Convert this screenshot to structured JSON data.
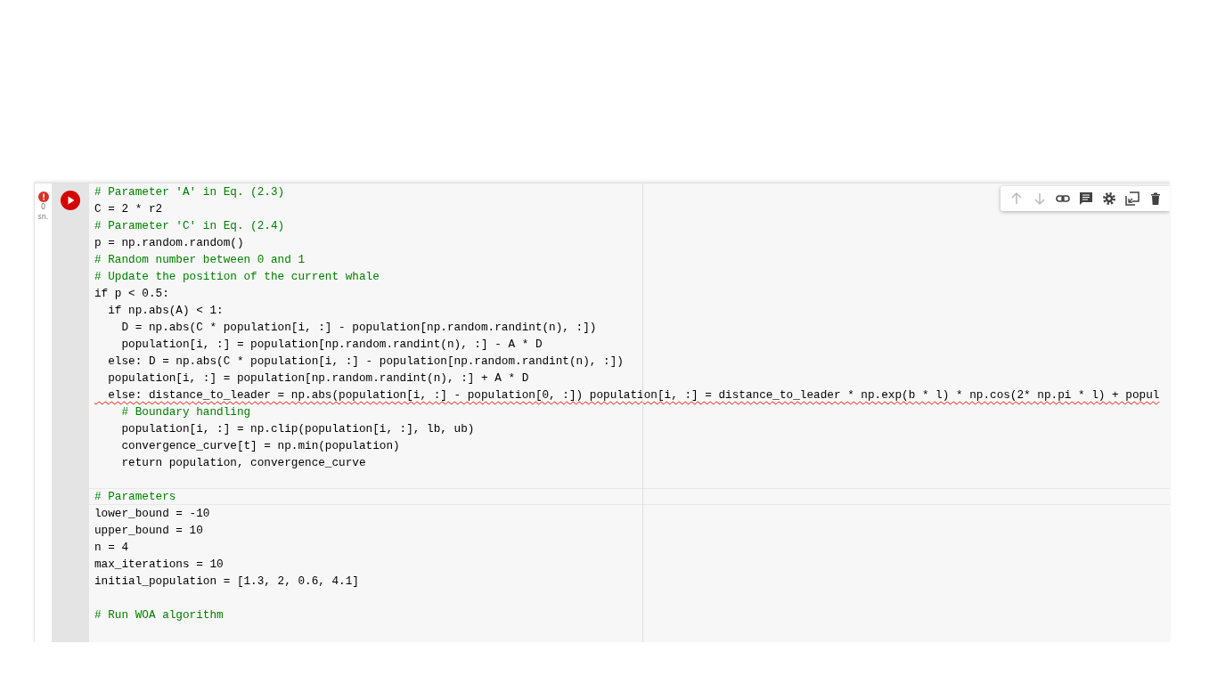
{
  "cell": {
    "status": {
      "error": true,
      "time": "0",
      "unit": "sn."
    },
    "toolbar": [
      {
        "kind": "up",
        "disabled": true
      },
      {
        "kind": "down",
        "disabled": true
      },
      {
        "kind": "link",
        "disabled": false
      },
      {
        "kind": "comment",
        "disabled": false
      },
      {
        "kind": "settings",
        "disabled": false
      },
      {
        "kind": "mirror",
        "disabled": false
      },
      {
        "kind": "delete",
        "disabled": false
      }
    ],
    "lines": [
      {
        "kind": "comment",
        "text": "# Parameter 'A' in Eq. (2.3)",
        "flagged": false
      },
      {
        "kind": "code",
        "text": "C = 2 * r2",
        "flagged": false
      },
      {
        "kind": "comment",
        "text": "# Parameter 'C' in Eq. (2.4)",
        "flagged": false
      },
      {
        "kind": "code",
        "text": "p = np.random.random()",
        "flagged": false
      },
      {
        "kind": "comment",
        "text": "# Random number between 0 and 1",
        "flagged": false
      },
      {
        "kind": "comment",
        "text": "# Update the position of the current whale",
        "flagged": false
      },
      {
        "kind": "code",
        "text": "if p < 0.5:",
        "flagged": false
      },
      {
        "kind": "code",
        "text": "  if np.abs(A) < 1:",
        "flagged": false
      },
      {
        "kind": "code",
        "text": "    D = np.abs(C * population[i, :] - population[np.random.randint(n), :])",
        "flagged": false
      },
      {
        "kind": "code",
        "text": "    population[i, :] = population[np.random.randint(n), :] - A * D",
        "flagged": false
      },
      {
        "kind": "code",
        "text": "  else: D = np.abs(C * population[i, :] - population[np.random.randint(n), :])",
        "flagged": false
      },
      {
        "kind": "code",
        "text": "  population[i, :] = population[np.random.randint(n), :] + A * D",
        "flagged": false
      },
      {
        "kind": "code",
        "text": "  else: distance_to_leader = np.abs(population[i, :] - population[0, :]) population[i, :] = distance_to_leader * np.exp(b * l) * np.cos(2* np.pi * l) + popul",
        "flagged": true
      },
      {
        "kind": "comment",
        "text": "    # Boundary handling",
        "flagged": false
      },
      {
        "kind": "code",
        "text": "    population[i, :] = np.clip(population[i, :], lb, ub)",
        "flagged": false
      },
      {
        "kind": "code",
        "text": "    convergence_curve[t] = np.min(population)",
        "flagged": false
      },
      {
        "kind": "code",
        "text": "    return population, convergence_curve",
        "flagged": false
      },
      {
        "kind": "blank"
      },
      {
        "kind": "comment",
        "text": "# Parameters",
        "flagged": false
      },
      {
        "kind": "code",
        "text": "lower_bound = -10",
        "flagged": false
      },
      {
        "kind": "code",
        "text": "upper_bound = 10",
        "flagged": false
      },
      {
        "kind": "code",
        "text": "n = 4",
        "flagged": false
      },
      {
        "kind": "code",
        "text": "max_iterations = 10",
        "flagged": false
      },
      {
        "kind": "code",
        "text": "initial_population = [1.3, 2, 0.6, 4.1]",
        "flagged": false
      },
      {
        "kind": "blank"
      },
      {
        "kind": "comment",
        "text": "# Run WOA algorithm",
        "flagged": false
      }
    ]
  }
}
